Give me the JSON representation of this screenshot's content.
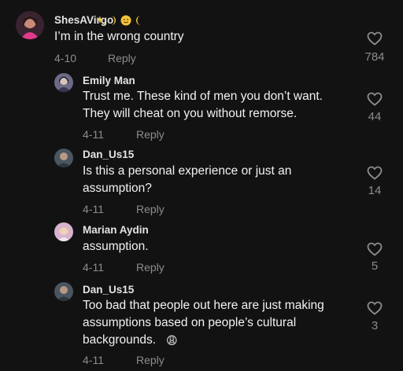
{
  "comments": [
    {
      "username": "ShesAVirgo",
      "text_lines": [
        "I’m in the wrong country"
      ],
      "date": "4-10",
      "reply_label": "Reply",
      "likes": "784",
      "badge_icons": [
        "sparkles-icon",
        "crescent-moon-icon",
        "smiley-face-icon",
        "crescent-moon-icon"
      ]
    },
    {
      "username": "Emily Man",
      "text_lines": [
        "Trust me. These kind of men you don’t want.",
        "They will cheat on you without remorse."
      ],
      "date": "4-11",
      "reply_label": "Reply",
      "likes": "44"
    },
    {
      "username": "Dan_Us15",
      "text_lines": [
        "Is this a personal experience or just an",
        "assumption?"
      ],
      "date": "4-11",
      "reply_label": "Reply",
      "likes": "14"
    },
    {
      "username": "Marian Aydin",
      "text_lines": [
        "assumption."
      ],
      "date": "4-11",
      "reply_label": "Reply",
      "likes": "5"
    },
    {
      "username": "Dan_Us15",
      "text_lines": [
        "Too bad that people out here are just making",
        "assumptions based on people’s cultural",
        "backgrounds."
      ],
      "emoji": "😩",
      "date": "4-11",
      "reply_label": "Reply",
      "likes": "3"
    }
  ],
  "colors": {
    "background": "#121212",
    "text": "#f2f2f2",
    "muted": "#8c8c8c"
  }
}
